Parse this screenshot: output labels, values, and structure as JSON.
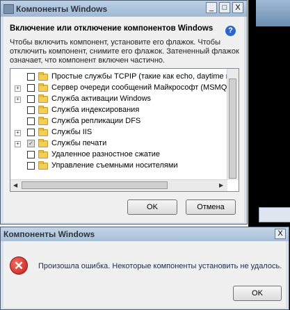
{
  "main_window": {
    "title": "Компоненты Windows",
    "minimize_glyph": "_",
    "maximize_glyph": "□",
    "close_glyph": "X",
    "heading": "Включение или отключение компонентов Windows",
    "help_glyph": "?",
    "description": "Чтобы включить компонент, установите его флажок. Чтобы отключить компонент, снимите его флажок. Затененный флажок означает, что компонент включен частично.",
    "features": [
      {
        "label": "Простые службы TCPIP (такие как echo, daytime и т.п.)",
        "expandable": false,
        "state": "unchecked"
      },
      {
        "label": "Сервер очереди сообщений Майкрософт (MSMQ)",
        "expandable": true,
        "state": "unchecked"
      },
      {
        "label": "Служба активации Windows",
        "expandable": true,
        "state": "unchecked"
      },
      {
        "label": "Служба индексирования",
        "expandable": false,
        "state": "unchecked"
      },
      {
        "label": "Служба репликации DFS",
        "expandable": false,
        "state": "unchecked"
      },
      {
        "label": "Службы IIS",
        "expandable": true,
        "state": "unchecked"
      },
      {
        "label": "Службы печати",
        "expandable": true,
        "state": "partial"
      },
      {
        "label": "Удаленное разностное сжатие",
        "expandable": false,
        "state": "unchecked"
      },
      {
        "label": "Управление съемными носителями",
        "expandable": false,
        "state": "unchecked"
      }
    ],
    "ok_label": "OK",
    "cancel_label": "Отмена"
  },
  "error_dialog": {
    "title": "Компоненты Windows",
    "close_glyph": "X",
    "icon_glyph": "✕",
    "message": "Произошла ошибка. Некоторые компоненты установить не удалось.",
    "ok_label": "OK"
  }
}
